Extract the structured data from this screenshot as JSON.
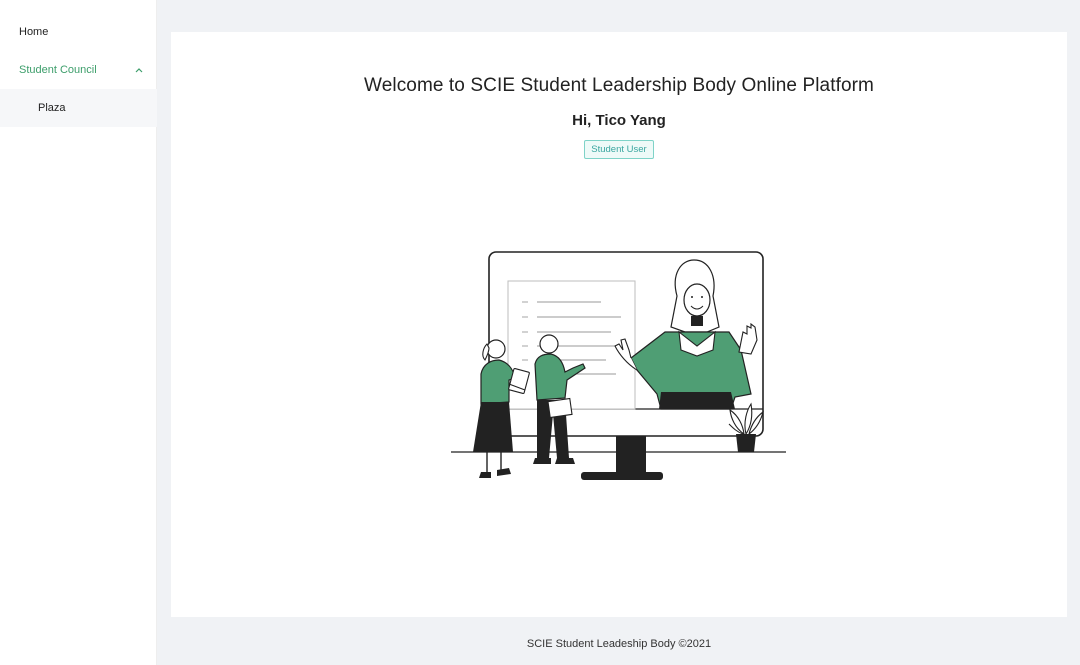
{
  "sidebar": {
    "items": [
      {
        "label": "Home"
      },
      {
        "label": "Student Council",
        "expanded": true,
        "submenu": [
          {
            "label": "Plaza"
          }
        ]
      }
    ]
  },
  "main": {
    "welcome_title": "Welcome to SCIE Student Leadership Body Online Platform",
    "greeting": "Hi, Tico Yang",
    "role_badge": "Student User",
    "illustration": "online-classroom-illustration"
  },
  "footer": {
    "text": "SCIE Student Leadeship Body ©2021"
  },
  "colors": {
    "accent_green": "#3d9e6b",
    "illustration_green": "#4f9e74",
    "badge_teal": "#3aa6a0",
    "page_background": "#f0f2f5"
  }
}
